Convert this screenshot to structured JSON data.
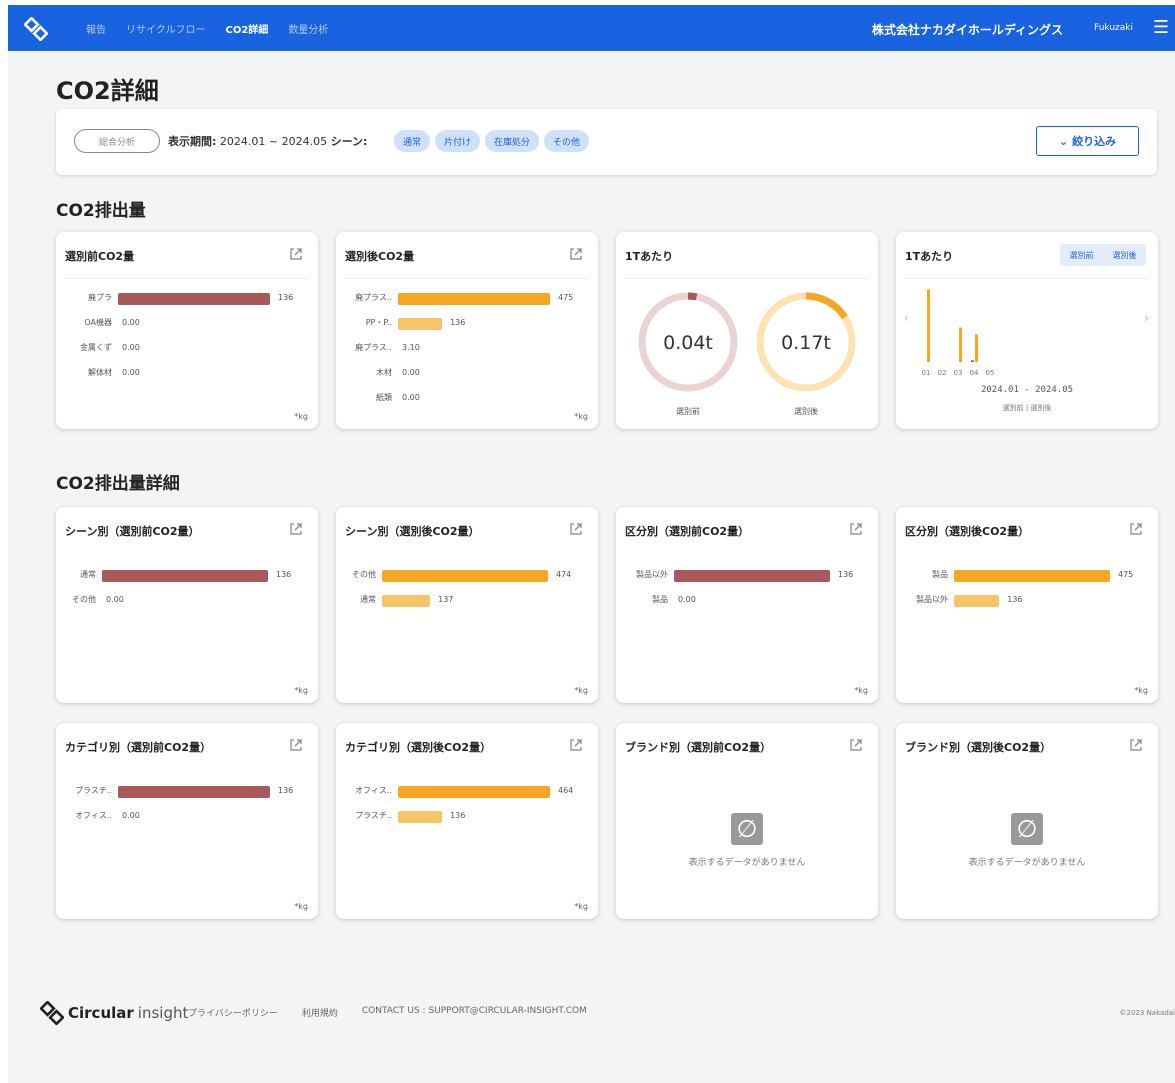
{
  "topbar": {
    "nav": [
      {
        "label": "報告",
        "active": false
      },
      {
        "label": "リサイクルフロー",
        "active": false
      },
      {
        "label": "CO2詳細",
        "active": true
      },
      {
        "label": "数量分析",
        "active": false
      }
    ],
    "company": "株式会社ナカダイホールディングス",
    "user": "Fukuzaki"
  },
  "page_title": "CO2詳細",
  "filter": {
    "analyze_button": "総合分析",
    "period_label": "表示期間:",
    "period_value": "2024.01 ~ 2024.05",
    "scene_label": "シーン:",
    "chips": [
      "通常",
      "片付け",
      "在庫処分",
      "その他"
    ],
    "filter_button": "絞り込み"
  },
  "section1_title": "CO2排出量",
  "section2_title": "CO2排出量詳細",
  "unit": "*kg",
  "cards": {
    "pre_sort": {
      "title": "選別前CO2量",
      "rows": [
        {
          "label": "廃プラ",
          "value": "136",
          "fraction": 1.0,
          "color": "red"
        },
        {
          "label": "OA機器",
          "value": "0.00",
          "fraction": 0,
          "color": "red"
        },
        {
          "label": "金属くず",
          "value": "0.00",
          "fraction": 0,
          "color": "red"
        },
        {
          "label": "解体材",
          "value": "0.00",
          "fraction": 0,
          "color": "red"
        }
      ]
    },
    "post_sort": {
      "title": "選別後CO2量",
      "rows": [
        {
          "label": "廃プラス..",
          "value": "475",
          "fraction": 1.0,
          "color": "orange"
        },
        {
          "label": "PP・P..",
          "value": "136",
          "fraction": 0.29,
          "color": "lorange"
        },
        {
          "label": "廃プラス..",
          "value": "3.10",
          "fraction": 0,
          "color": "orange"
        },
        {
          "label": "木材",
          "value": "0.00",
          "fraction": 0,
          "color": "orange"
        },
        {
          "label": "紙類",
          "value": "0.00",
          "fraction": 0,
          "color": "orange"
        }
      ]
    },
    "per_ton": {
      "title": "1Tあたり",
      "gauges": [
        {
          "value": "0.04t",
          "label": "選別前",
          "fraction": 0.03,
          "color": "#a85858",
          "track": "#ead3d3"
        },
        {
          "value": "0.17t",
          "label": "選別後",
          "fraction": 0.16,
          "color": "#f5a623",
          "track": "#fbe3b4"
        }
      ]
    },
    "per_ton_chart": {
      "title": "1Tあたり",
      "toggle": [
        "選別前",
        "選別後"
      ],
      "period": "2024.01 - 2024.05",
      "legend": "選別前 | 選別後",
      "chart_data": {
        "type": "bar",
        "categories": [
          "01",
          "02",
          "03",
          "04",
          "05"
        ],
        "series": [
          {
            "name": "選別前",
            "color": "#a85858",
            "values": [
              0,
              0,
              0,
              0.005,
              0
            ]
          },
          {
            "name": "選別後",
            "color": "#f5a623",
            "values": [
              0.21,
              0,
              0.1,
              0.08,
              0
            ]
          }
        ],
        "ylim": [
          0,
          0.22
        ]
      }
    },
    "scene_pre": {
      "title": "シーン別（選別前CO2量）",
      "rows": [
        {
          "label": "通常",
          "value": "136",
          "fraction": 1.0,
          "color": "red"
        },
        {
          "label": "その他",
          "value": "0.00",
          "fraction": 0,
          "color": "red"
        }
      ]
    },
    "scene_post": {
      "title": "シーン別（選別後CO2量）",
      "rows": [
        {
          "label": "その他",
          "value": "474",
          "fraction": 1.0,
          "color": "orange"
        },
        {
          "label": "通常",
          "value": "137",
          "fraction": 0.29,
          "color": "lorange"
        }
      ]
    },
    "class_pre": {
      "title": "区分別（選別前CO2量）",
      "rows": [
        {
          "label": "製品以外",
          "value": "136",
          "fraction": 1.0,
          "color": "red"
        },
        {
          "label": "製品",
          "value": "0.00",
          "fraction": 0,
          "color": "red"
        }
      ]
    },
    "class_post": {
      "title": "区分別（選別後CO2量）",
      "rows": [
        {
          "label": "製品",
          "value": "475",
          "fraction": 1.0,
          "color": "orange"
        },
        {
          "label": "製品以外",
          "value": "136",
          "fraction": 0.29,
          "color": "lorange"
        }
      ]
    },
    "category_pre": {
      "title": "カテゴリ別（選別前CO2量）",
      "rows": [
        {
          "label": "プラスチ..",
          "value": "136",
          "fraction": 1.0,
          "color": "red"
        },
        {
          "label": "オフィス..",
          "value": "0.00",
          "fraction": 0,
          "color": "red"
        }
      ]
    },
    "category_post": {
      "title": "カテゴリ別（選別後CO2量）",
      "rows": [
        {
          "label": "オフィス..",
          "value": "464",
          "fraction": 1.0,
          "color": "orange"
        },
        {
          "label": "プラスチ..",
          "value": "136",
          "fraction": 0.29,
          "color": "lorange"
        }
      ]
    },
    "brand_pre": {
      "title": "ブランド別（選別前CO2量）",
      "nodata": "表示するデータがありません"
    },
    "brand_post": {
      "title": "ブランド別（選別後CO2量）",
      "nodata": "表示するデータがありません"
    }
  },
  "footer": {
    "brand_bold": "Circular",
    "brand_lite": "insight",
    "links": [
      "プライバシーポリシー",
      "利用規約",
      "CONTACT US : SUPPORT@CIRCULAR-INSIGHT.COM"
    ],
    "copyright": "©2023 Nakadai"
  },
  "colors": {
    "primary": "#1a63e0",
    "red": "#a85858",
    "orange": "#f5a623",
    "lorange": "#f8c46a"
  }
}
